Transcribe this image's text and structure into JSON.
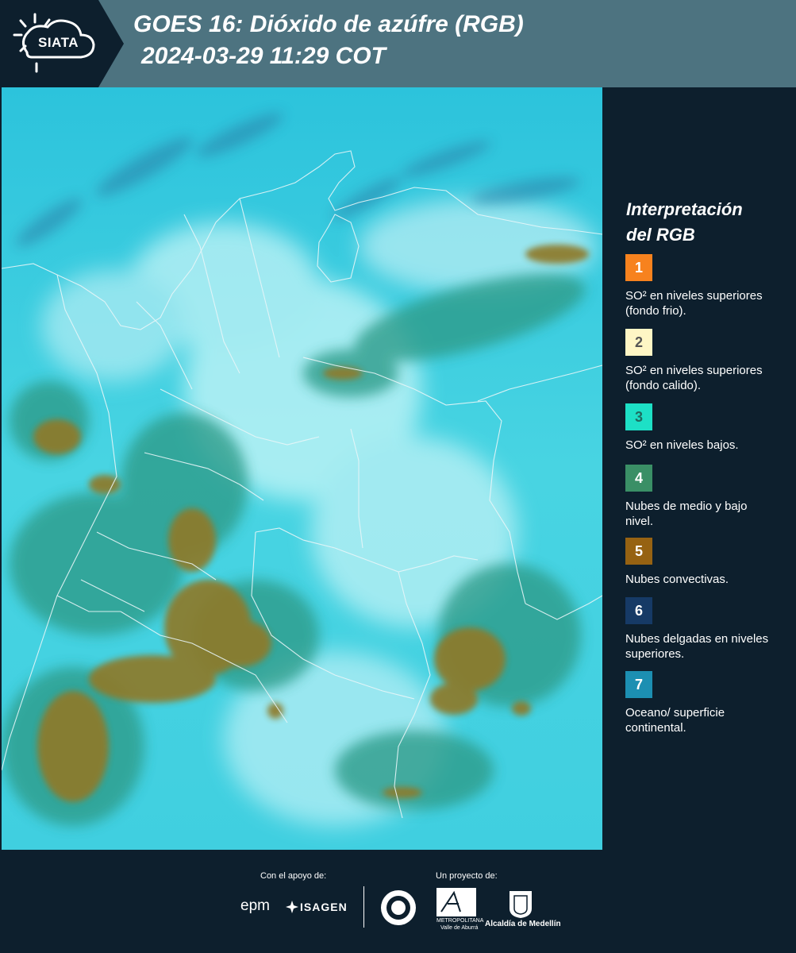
{
  "header": {
    "logo_text": "SIATA",
    "title_line1": "GOES 16: Dióxido de azúfre (RGB)",
    "title_line2": " 2024-03-29 11:29 COT"
  },
  "legend": {
    "title_line1": "Interpretación",
    "title_line2": "del RGB",
    "items": [
      {
        "num": "1",
        "color": "#f7821e",
        "num_color": "#ffffff",
        "label": "SO² en niveles superiores (fondo frio)."
      },
      {
        "num": "2",
        "color": "#fef6c5",
        "num_color": "#555555",
        "label": "SO² en niveles superiores (fondo calido)."
      },
      {
        "num": "3",
        "color": "#1de0c6",
        "num_color": "#1f6b60",
        "label": "SO² en niveles bajos."
      },
      {
        "num": "4",
        "color": "#3a8f66",
        "num_color": "#ffffff",
        "label": "Nubes de medio y bajo nivel."
      },
      {
        "num": "5",
        "color": "#966212",
        "num_color": "#ffffff",
        "label": "Nubes convectivas."
      },
      {
        "num": "6",
        "color": "#163a66",
        "num_color": "#ffffff",
        "label": "Nubes delgadas en niveles superiores."
      },
      {
        "num": "7",
        "color": "#1c8fb2",
        "num_color": "#ffffff",
        "label": "Oceano/ superficie continental."
      }
    ]
  },
  "footer": {
    "support_label": "Con el apoyo de:",
    "project_label": "Un proyecto de:",
    "epm": "epm",
    "isagen": "ISAGEN",
    "area_line1": "METROPOLITANA",
    "area_line2": "Valle de Aburrá",
    "alcaldia": "Alcaldía de Medellín"
  }
}
